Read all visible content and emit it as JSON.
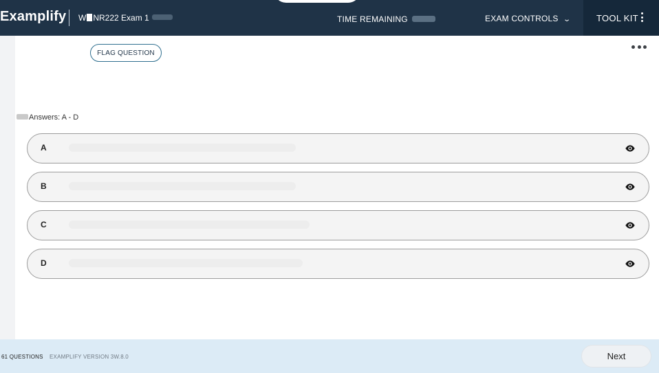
{
  "header": {
    "brand": "Examplify",
    "exam_title": "NR222 Exam 1",
    "exam_prefix": "W",
    "time_remaining_label": "TIME REMAINING",
    "exam_controls_label": "EXAM CONTROLS",
    "toolkit_label": "TOOL KIT"
  },
  "question": {
    "flag_label": "FLAG QUESTION",
    "answers_header": "Answers: A - D"
  },
  "options": [
    {
      "letter": "A"
    },
    {
      "letter": "B"
    },
    {
      "letter": "C"
    },
    {
      "letter": "D"
    }
  ],
  "footer": {
    "question_count": "61 QUESTIONS",
    "version": "EXAMPLIFY VERSION 3W.8.0",
    "next_label": "Next"
  },
  "icons": {
    "toolkit": "kebab-vertical-icon",
    "more": "more-horizontal-icon",
    "eye": "eye-icon",
    "exam_controls": "chevron-down-icon"
  },
  "colors": {
    "header_bg": "#1f3347",
    "toolkit_bg": "#15283a",
    "footer_bg": "#dcebf6",
    "flag_border": "#2f6f8f"
  }
}
